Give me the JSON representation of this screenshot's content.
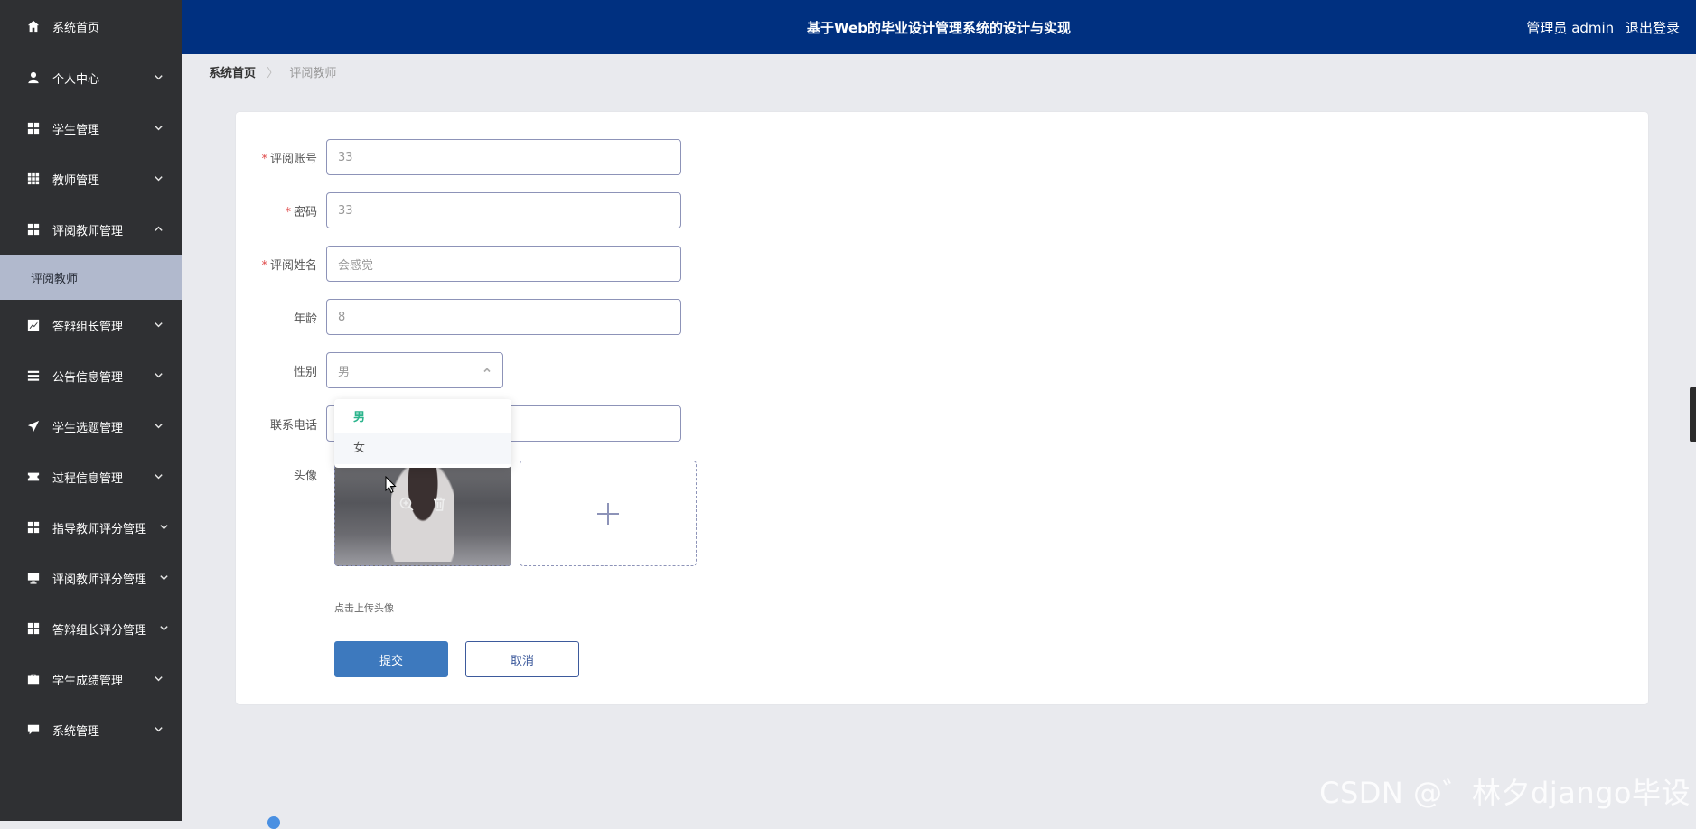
{
  "header": {
    "title": "基于Web的毕业设计管理系统的设计与实现",
    "user_label": "管理员 admin",
    "logout_label": "退出登录",
    "bg_color": "#003080"
  },
  "sidebar": {
    "items": [
      {
        "label": "系统首页",
        "icon": "home-icon"
      },
      {
        "label": "个人中心",
        "icon": "user-icon"
      },
      {
        "label": "学生管理",
        "icon": "grid-icon"
      },
      {
        "label": "教师管理",
        "icon": "table-icon"
      },
      {
        "label": "评阅教师管理",
        "icon": "grid-icon"
      },
      {
        "label": "答辩组长管理",
        "icon": "chart-icon"
      },
      {
        "label": "公告信息管理",
        "icon": "list-icon"
      },
      {
        "label": "学生选题管理",
        "icon": "send-icon"
      },
      {
        "label": "过程信息管理",
        "icon": "ticket-icon"
      },
      {
        "label": "指导教师评分管理",
        "icon": "grid-icon"
      },
      {
        "label": "评阅教师评分管理",
        "icon": "monitor-icon"
      },
      {
        "label": "答辩组长评分管理",
        "icon": "grid-icon"
      },
      {
        "label": "学生成绩管理",
        "icon": "briefcase-icon"
      },
      {
        "label": "系统管理",
        "icon": "chat-icon"
      }
    ],
    "active_sub": "评阅教师"
  },
  "breadcrumb": {
    "home": "系统首页",
    "separator": "〉",
    "current": "评阅教师"
  },
  "form": {
    "account": {
      "label": "评阅账号",
      "value": "33"
    },
    "password": {
      "label": "密码",
      "value": "33"
    },
    "name": {
      "label": "评阅姓名",
      "value": "会感觉"
    },
    "age": {
      "label": "年龄",
      "value": "8"
    },
    "gender": {
      "label": "性别",
      "value": "男",
      "options": [
        "男",
        "女"
      ]
    },
    "phone": {
      "label": "联系电话",
      "value": ""
    },
    "avatar": {
      "label": "头像",
      "hint": "点击上传头像"
    },
    "submit_label": "提交",
    "cancel_label": "取消"
  },
  "watermark": "CSDN @゛林夕django毕设"
}
